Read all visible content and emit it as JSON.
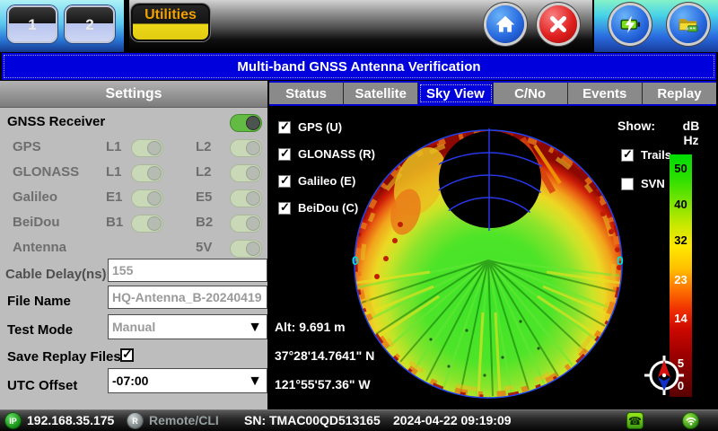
{
  "title": "Multi-band GNSS Antenna Verification",
  "top_bar": {
    "page1_label": "1",
    "page2_label": "2",
    "utilities_label": "Utilities",
    "icons": [
      "home-icon",
      "close-icon",
      "battery-charging-icon",
      "usb-folder-icon"
    ]
  },
  "settings": {
    "header": "Settings",
    "receiver_label": "GNSS Receiver",
    "receiver_on": true,
    "rows": [
      {
        "label": "GPS",
        "band1": "L1",
        "band1_on": true,
        "band2": "L2",
        "band2_on": true
      },
      {
        "label": "GLONASS",
        "band1": "L1",
        "band1_on": true,
        "band2": "L2",
        "band2_on": true
      },
      {
        "label": "Galileo",
        "band1": "E1",
        "band1_on": true,
        "band2": "E5",
        "band2_on": true
      },
      {
        "label": "BeiDou",
        "band1": "B1",
        "band1_on": true,
        "band2": "B2",
        "band2_on": true
      }
    ],
    "antenna_label": "Antenna",
    "antenna_band": "5V",
    "antenna_on": true,
    "cable_delay_label": "Cable Delay(ns)",
    "cable_delay_value": "155",
    "file_name_label": "File Name",
    "file_name_value": "HQ-Antenna_B-20240419",
    "test_mode_label": "Test Mode",
    "test_mode_value": "Manual",
    "save_replay_label": "Save Replay Files",
    "save_replay_checked": true,
    "utc_offset_label": "UTC Offset",
    "utc_offset_value": "-07:00"
  },
  "tabs": [
    {
      "label": "Status",
      "active": false
    },
    {
      "label": "Satellite",
      "active": false
    },
    {
      "label": "Sky View",
      "active": true
    },
    {
      "label": "C/No",
      "active": false
    },
    {
      "label": "Events",
      "active": false
    },
    {
      "label": "Replay",
      "active": false
    }
  ],
  "sky_view": {
    "constellations": [
      "GPS (U)",
      "GLONASS (R)",
      "Galileo (E)",
      "BeiDou (C)"
    ],
    "constellations_checked": [
      true,
      true,
      true,
      true
    ],
    "show_label": "Show:",
    "trails_label": "Trails",
    "trails_checked": true,
    "svn_label": "SVN",
    "svn_checked": false,
    "scale_unit_line1": "dB",
    "scale_unit_line2": "Hz",
    "scale_ticks": [
      "50",
      "40",
      "32",
      "23",
      "14",
      "5",
      "0"
    ],
    "horizon_label_left": "0",
    "horizon_label_right": "0",
    "altitude": "Alt: 9.691 m",
    "latitude": "37°28'14.7641\" N",
    "longitude": "121°55'57.36\" W"
  },
  "status_bar": {
    "ip_badge": "IP",
    "ip_address": "192.168.35.175",
    "remote_badge": "R",
    "remote_label": "Remote/CLI",
    "serial_number": "SN: TMAC00QD513165",
    "datetime": "2024-04-22  09:19:09",
    "icons": [
      "remote-access-icon",
      "wifi-icon"
    ]
  },
  "colors": {
    "accent_blue": "#0000dd",
    "tab_active_blue": "#0000dd",
    "toggle_on_green": "#64bb44",
    "utilities_text_orange": "#f0a000",
    "scale_top_green": "#00dc00",
    "scale_bottom_red": "#5a0000",
    "grid_blue": "#2838e8",
    "horizon_label_cyan": "#00e0e0"
  }
}
